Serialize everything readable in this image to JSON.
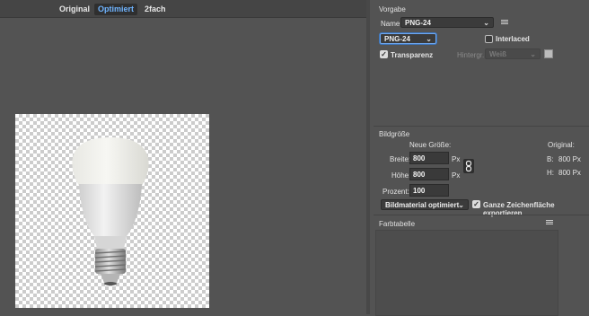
{
  "tabs": [
    {
      "label": "Original",
      "active": false
    },
    {
      "label": "Optimiert",
      "active": true
    },
    {
      "label": "2fach",
      "active": false
    }
  ],
  "vorgabe": {
    "title": "Vorgabe",
    "name_label": "Name:",
    "name_value": "PNG-24",
    "format_value": "PNG-24",
    "interlaced_label": "Interlaced",
    "interlaced_checked": false,
    "transparenz_label": "Transparenz",
    "transparenz_checked": true,
    "hintergrund_label": "Hintergr.:",
    "hintergrund_value": "Weiß"
  },
  "bildgroesse": {
    "title": "Bildgröße",
    "neue_groesse_label": "Neue Größe:",
    "original_label": "Original:",
    "breite_label": "Breite:",
    "breite_value": "800",
    "hoehe_label": "Höhe:",
    "hoehe_value": "800",
    "unit": "Px",
    "prozent_label": "Prozent:",
    "prozent_value": "100",
    "orig_b_label": "B:",
    "orig_b_value": "800 Px",
    "orig_h_label": "H:",
    "orig_h_value": "800 Px",
    "resample_value": "Bildmaterial optimiert",
    "artboard_label": "Ganze Zeichenfläche exportieren",
    "artboard_checked": true
  },
  "farbtabelle": {
    "title": "Farbtabelle"
  },
  "icons": {
    "panel_menu": "menu-lines-icon",
    "link": "chain-link-icon",
    "swatch": "color-swatch-icon"
  }
}
